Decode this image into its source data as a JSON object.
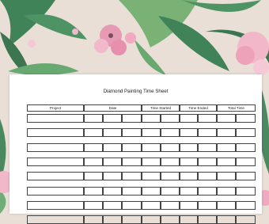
{
  "sheet": {
    "title": "Diamond Painting Time Sheet",
    "columns": [
      "Project",
      "Date",
      "Time Started",
      "Time Ended",
      "Total Time"
    ],
    "date_separator": "/",
    "time_separator": ":",
    "row_count": 8
  },
  "colors": {
    "background": "#e9dfd6",
    "leaf": "#2f7a4c",
    "leaf_light": "#6fae6b",
    "flower": "#e79ab4",
    "grid": "#444444"
  },
  "icons": [
    "palm-leaf-icon",
    "flower-icon"
  ]
}
